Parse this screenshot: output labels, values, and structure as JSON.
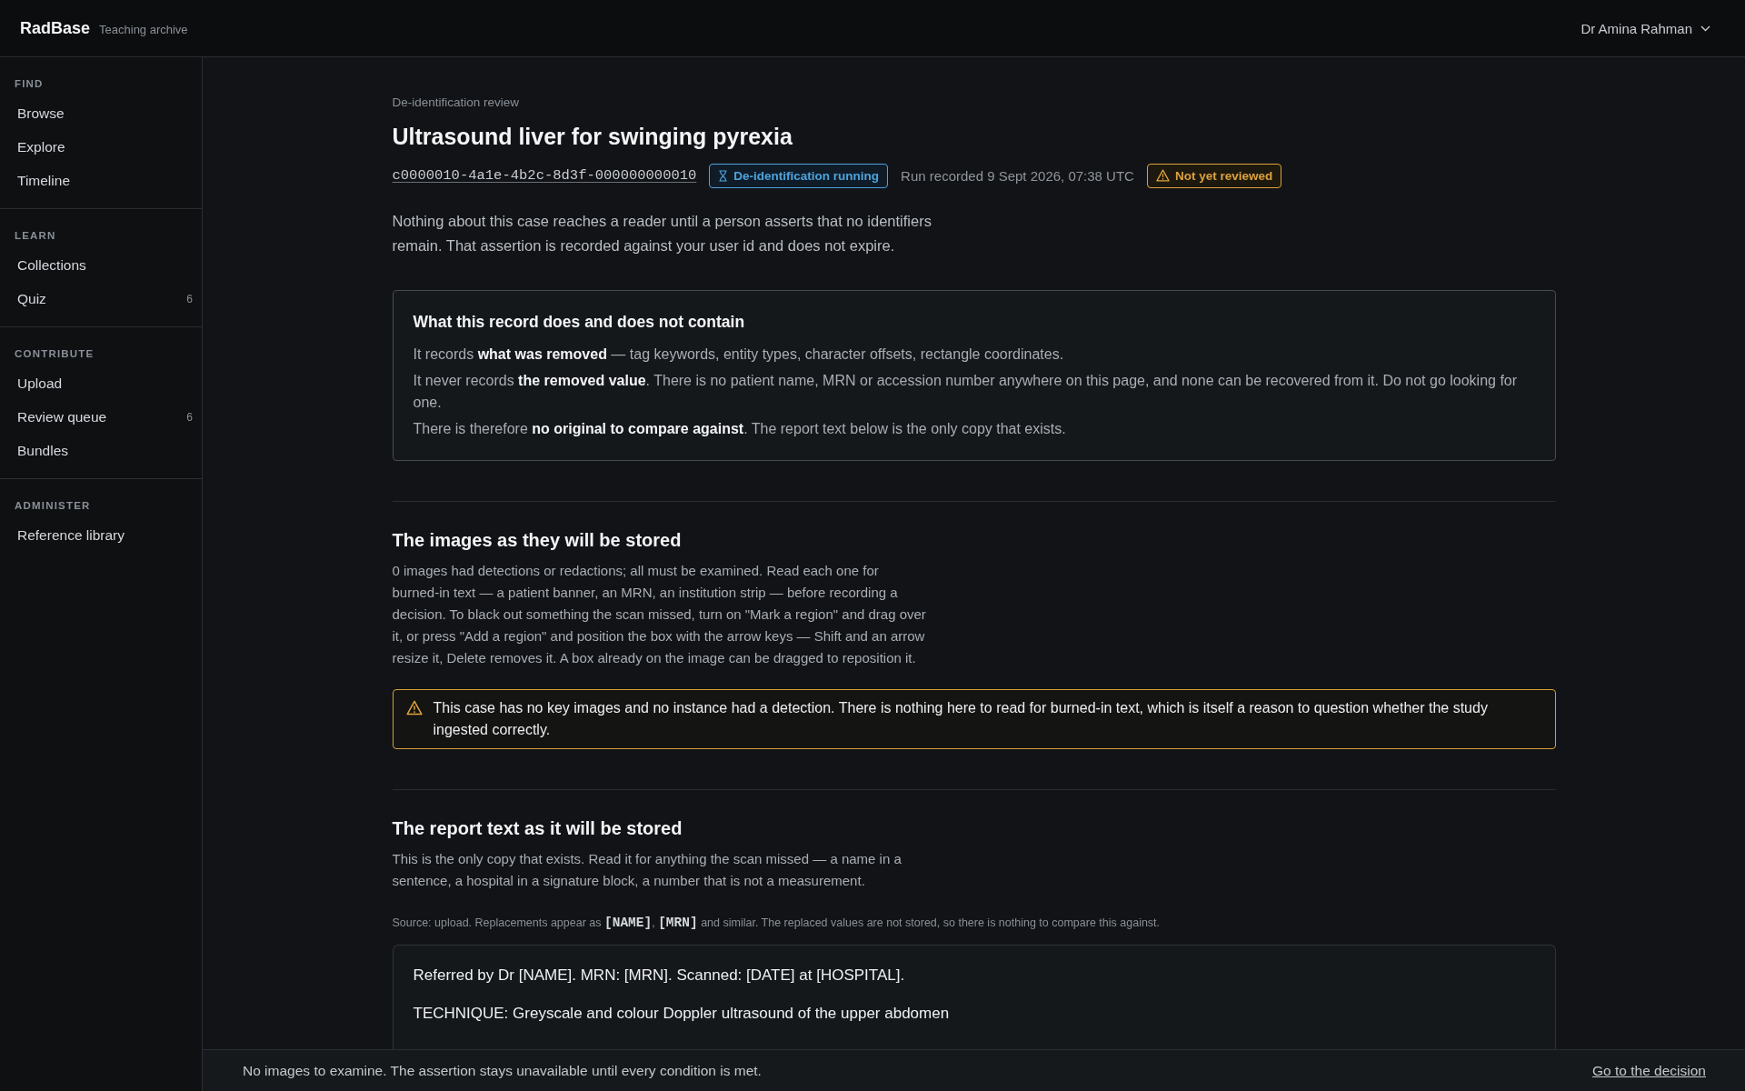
{
  "topbar": {
    "logo": "RadBase",
    "subtitle": "Teaching archive",
    "user": "Dr Amina Rahman"
  },
  "sidebar": [
    {
      "label": "FIND",
      "items": [
        {
          "label": "Browse",
          "selected": false
        },
        {
          "label": "Explore",
          "selected": false
        },
        {
          "label": "Timeline",
          "selected": false
        }
      ]
    },
    {
      "label": "LEARN",
      "items": [
        {
          "label": "Collections",
          "selected": false
        },
        {
          "label": "Quiz",
          "count": "6",
          "selected": false
        }
      ]
    },
    {
      "label": "CONTRIBUTE",
      "items": [
        {
          "label": "Upload",
          "selected": false
        },
        {
          "label": "Review queue",
          "count": "6",
          "selected": false
        },
        {
          "label": "Bundles",
          "selected": false
        }
      ]
    },
    {
      "label": "ADMINISTER",
      "items": [
        {
          "label": "Reference library",
          "selected": false
        }
      ]
    }
  ],
  "header": {
    "breadcrumb": "De-identification review",
    "title": "Ultrasound liver for swinging pyrexia",
    "case_id": "c0000010-4a1e-4b2c-8d3f-000000000010",
    "meta": [
      {
        "kind": "status",
        "text": "De-identification running",
        "color": "#4ea3dc"
      },
      {
        "kind": "text",
        "text": "Run recorded 9 Sept 2026, 07:38 UTC"
      },
      {
        "kind": "warning",
        "text": "Not yet reviewed",
        "color": "#dca23e"
      }
    ],
    "intro": "Nothing about this case reaches a reader until a person asserts that no identifiers remain. That assertion is recorded against your user id and does not expire."
  },
  "record_box": {
    "title": "What this record does and does not contain",
    "lines": [
      "It records **what was removed** — tag keywords, entity types, character offsets, rectangle coordinates.",
      "It never records **the removed value**. There is no patient name, MRN or accession number anywhere on this page, and none can be recovered from it. Do not go looking for one.",
      "There is therefore **no original to compare against**. The report text below is the only copy that exists."
    ]
  },
  "images_section": {
    "heading": "The images as they will be stored",
    "body": "0 images had detections or redactions; all must be examined. Read each one for burned-in text — a patient banner, an MRN, an institution strip — before recording a decision. To black out something the scan missed, turn on \"Mark a region\" and drag over it, or press \"Add a region\" and position the box with the arrow keys — Shift and an arrow resize it, Delete removes it. A box already on the image can be dragged to reposition it.",
    "alert": "This case has no key images and no instance had a detection. There is nothing here to read for burned-in text, which is itself a reason to question whether the study ingested correctly."
  },
  "report_section": {
    "heading": "The report text as it will be stored",
    "body": "This is the only copy that exists. Read it for anything the scan missed — a name in a sentence, a hospital in a signature block, a number that is not a measurement.",
    "source_note": [
      {
        "kind": "text",
        "text": "Source: upload. Replacements appear as "
      },
      {
        "kind": "code",
        "text": "[NAME]"
      },
      {
        "kind": "text",
        "text": ", "
      },
      {
        "kind": "code",
        "text": "[MRN]"
      },
      {
        "kind": "text",
        "text": " and similar. The replaced values are not stored, so there is nothing to compare this against."
      }
    ],
    "report_lines": [
      "Referred by Dr [NAME]. MRN: [MRN]. Scanned: [DATE] at [HOSPITAL].",
      "TECHNIQUE: Greyscale and colour Doppler ultrasound of the upper abdomen"
    ]
  },
  "footer": {
    "message": "No images to examine. The assertion stays unavailable until every condition is met.",
    "link": "Go to the decision"
  }
}
